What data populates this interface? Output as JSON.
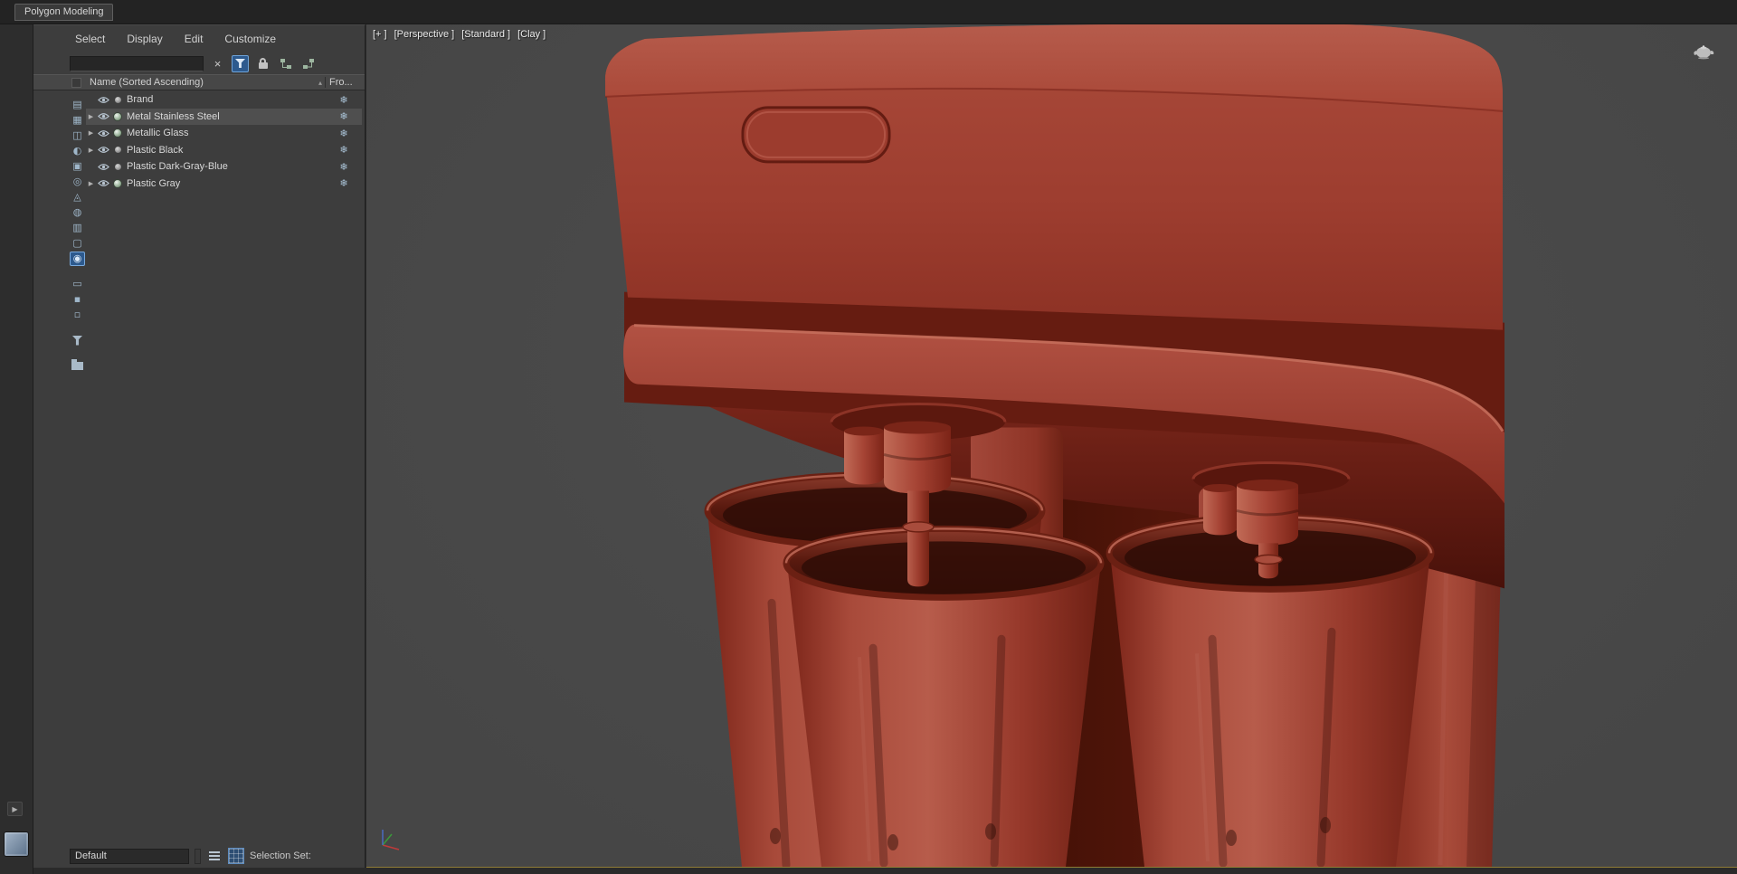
{
  "window": {
    "tab_title": "Polygon Modeling"
  },
  "explorer": {
    "menu": [
      "Select",
      "Display",
      "Edit",
      "Customize"
    ],
    "search": {
      "value": ""
    },
    "glyphs": {
      "expand": "▶",
      "frozen": "❄",
      "clear": "×",
      "sort": "▴"
    },
    "columns": {
      "name": "Name (Sorted Ascending)",
      "frozen": "Fro..."
    },
    "rows": [
      {
        "name": "Brand",
        "arrow": false,
        "icon": "dot",
        "eye": true,
        "frozen": true,
        "selected": false
      },
      {
        "name": "Metal Stainless Steel",
        "arrow": true,
        "icon": "material",
        "eye": true,
        "frozen": true,
        "selected": true
      },
      {
        "name": "Metallic Glass",
        "arrow": true,
        "icon": "material",
        "eye": true,
        "frozen": true,
        "selected": false
      },
      {
        "name": "Plastic Black",
        "arrow": true,
        "icon": "dot",
        "eye": true,
        "frozen": true,
        "selected": false
      },
      {
        "name": "Plastic Dark-Gray-Blue",
        "arrow": false,
        "icon": "dot",
        "eye": true,
        "frozen": true,
        "selected": false
      },
      {
        "name": "Plastic Gray",
        "arrow": true,
        "icon": "material",
        "eye": true,
        "frozen": true,
        "selected": false
      }
    ],
    "side_icons": [
      {
        "name": "display-influences-toggle",
        "glyph": "▤"
      },
      {
        "name": "display-geometry-toggle",
        "glyph": "▦"
      },
      {
        "name": "display-shapes-toggle",
        "glyph": "◫"
      },
      {
        "name": "display-lights-toggle",
        "glyph": "◐"
      },
      {
        "name": "display-cameras-toggle",
        "glyph": "▣"
      },
      {
        "name": "display-helpers-toggle",
        "glyph": "◎"
      },
      {
        "name": "display-spacewarps-toggle",
        "glyph": "◬"
      },
      {
        "name": "display-particles-toggle",
        "glyph": "◍"
      },
      {
        "name": "display-bones-toggle",
        "glyph": "▥"
      },
      {
        "name": "display-containers-toggle",
        "glyph": "▢"
      },
      {
        "name": "display-materials-toggle",
        "glyph": "◉",
        "active": true
      },
      {
        "name": "select-all-button",
        "glyph": "▭",
        "gap": true
      },
      {
        "name": "select-none-button",
        "glyph": "▪"
      },
      {
        "name": "select-invert-button",
        "glyph": "▫"
      },
      {
        "name": "filter-selection-button",
        "shape": "funnel",
        "gap": true
      },
      {
        "name": "container-explorer-button",
        "shape": "folder",
        "gap": true
      }
    ],
    "bottom": {
      "preset": "Default",
      "selection_set_label": "Selection Set:"
    }
  },
  "viewport": {
    "labels": [
      {
        "text": "[+ ]",
        "name": "viewport-general-menu"
      },
      {
        "text": "[Perspective ]",
        "name": "viewport-pov-menu"
      },
      {
        "text": "[Standard ]",
        "name": "viewport-standard-menu"
      },
      {
        "text": "[Clay ]",
        "name": "viewport-shading-menu"
      }
    ]
  },
  "colors": {
    "clay_base": "#a04130",
    "clay_highlight": "#b75c4b",
    "clay_shadow": "#5c180e",
    "viewport_bg": "#4a4a4a",
    "panel_bg": "#3d3d3d",
    "accent_blue": "#2d5a8e",
    "active_border_yellow": "#8f7d36"
  }
}
